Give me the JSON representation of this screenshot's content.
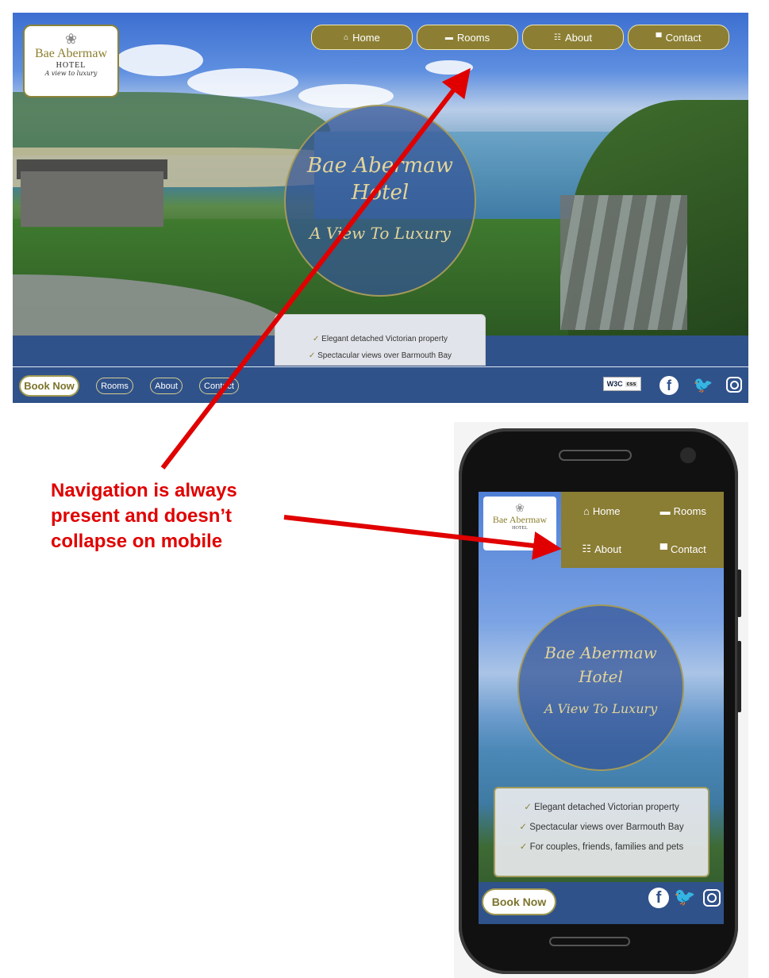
{
  "desktop": {
    "logo": {
      "name": "Bae Abermaw",
      "subtitle": "HOTEL",
      "tagline": "A view to luxury"
    },
    "nav": [
      {
        "label": "Home",
        "icon": "home-icon",
        "glyph": "⌂"
      },
      {
        "label": "Rooms",
        "icon": "bed-icon",
        "glyph": "▬"
      },
      {
        "label": "About",
        "icon": "people-icon",
        "glyph": "☷"
      },
      {
        "label": "Contact",
        "icon": "chat-icon",
        "glyph": "▀"
      }
    ],
    "hero": {
      "title_line1": "Bae Abermaw",
      "title_line2": "Hotel",
      "tagline": "A View To Luxury"
    },
    "features": [
      "Elegant detached Victorian property",
      "Spectacular views over Barmouth Bay"
    ],
    "tick": "✓",
    "footer": {
      "book_now": "Book Now",
      "links": [
        "Rooms",
        "About",
        "Contact"
      ],
      "w3c": "W3C",
      "css": "css",
      "social": {
        "facebook": "f",
        "twitter": "🐦"
      }
    }
  },
  "annotation": "Navigation is always present and doesn’t collapse on mobile",
  "mobile": {
    "logo": {
      "name": "Bae Abermaw",
      "subtitle": "HOTEL"
    },
    "nav": [
      {
        "label": "Home",
        "glyph": "⌂"
      },
      {
        "label": "Rooms",
        "glyph": "▬"
      },
      {
        "label": "About",
        "glyph": "☷"
      },
      {
        "label": "Contact",
        "glyph": "▀"
      }
    ],
    "hero": {
      "title_line1": "Bae Abermaw",
      "title_line2": "Hotel",
      "tagline": "A View To Luxury"
    },
    "features": [
      "Elegant detached Victorian property",
      "Spectacular views over Barmouth Bay",
      "For couples, friends, families and pets"
    ],
    "book_now": "Book Now",
    "social": {
      "facebook": "f",
      "twitter": "🐦"
    }
  },
  "colors": {
    "olive": "#8c7f33",
    "navy": "#30528a",
    "annotation_red": "#e00000",
    "gold_text": "#e3d49a"
  }
}
